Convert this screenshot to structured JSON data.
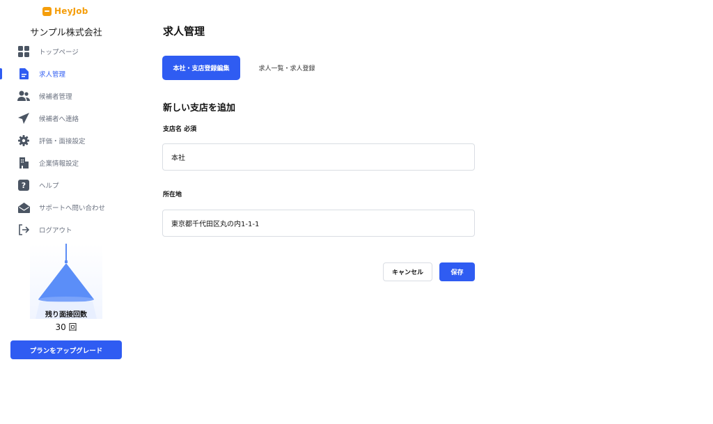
{
  "brand": {
    "logo_text": "HeyJob",
    "accent_color": "#2f5cf2",
    "logo_color": "#f59e0b"
  },
  "sidebar": {
    "company_name": "サンプル株式会社",
    "items": [
      {
        "label": "トップページ",
        "icon": "grid-icon",
        "active": false
      },
      {
        "label": "求人管理",
        "icon": "document-icon",
        "active": true
      },
      {
        "label": "候補者管理",
        "icon": "users-icon",
        "active": false
      },
      {
        "label": "候補者へ連絡",
        "icon": "paper-plane-icon",
        "active": false
      },
      {
        "label": "評価・面接設定",
        "icon": "gear-icon",
        "active": false
      },
      {
        "label": "企業情報設定",
        "icon": "building-icon",
        "active": false
      },
      {
        "label": "ヘルプ",
        "icon": "help-icon",
        "active": false
      },
      {
        "label": "サポートへ問い合わせ",
        "icon": "envelope-open-icon",
        "active": false
      },
      {
        "label": "ログアウト",
        "icon": "logout-icon",
        "active": false
      }
    ],
    "remaining_label": "残り面接回数",
    "remaining_count": "30 回",
    "upgrade_label": "プランをアップグレード"
  },
  "main": {
    "title": "求人管理",
    "tabs": [
      {
        "label": "本社・支店登録編集",
        "active": true
      },
      {
        "label": "求人一覧・求人登録",
        "active": false
      }
    ],
    "section_title": "新しい支店を追加",
    "form": {
      "branch_label": "支店名 必須",
      "branch_value": "本社",
      "address_label": "所在地",
      "address_value": "東京都千代田区丸の内1-1-1"
    },
    "cancel_label": "キャンセル",
    "save_label": "保存"
  }
}
